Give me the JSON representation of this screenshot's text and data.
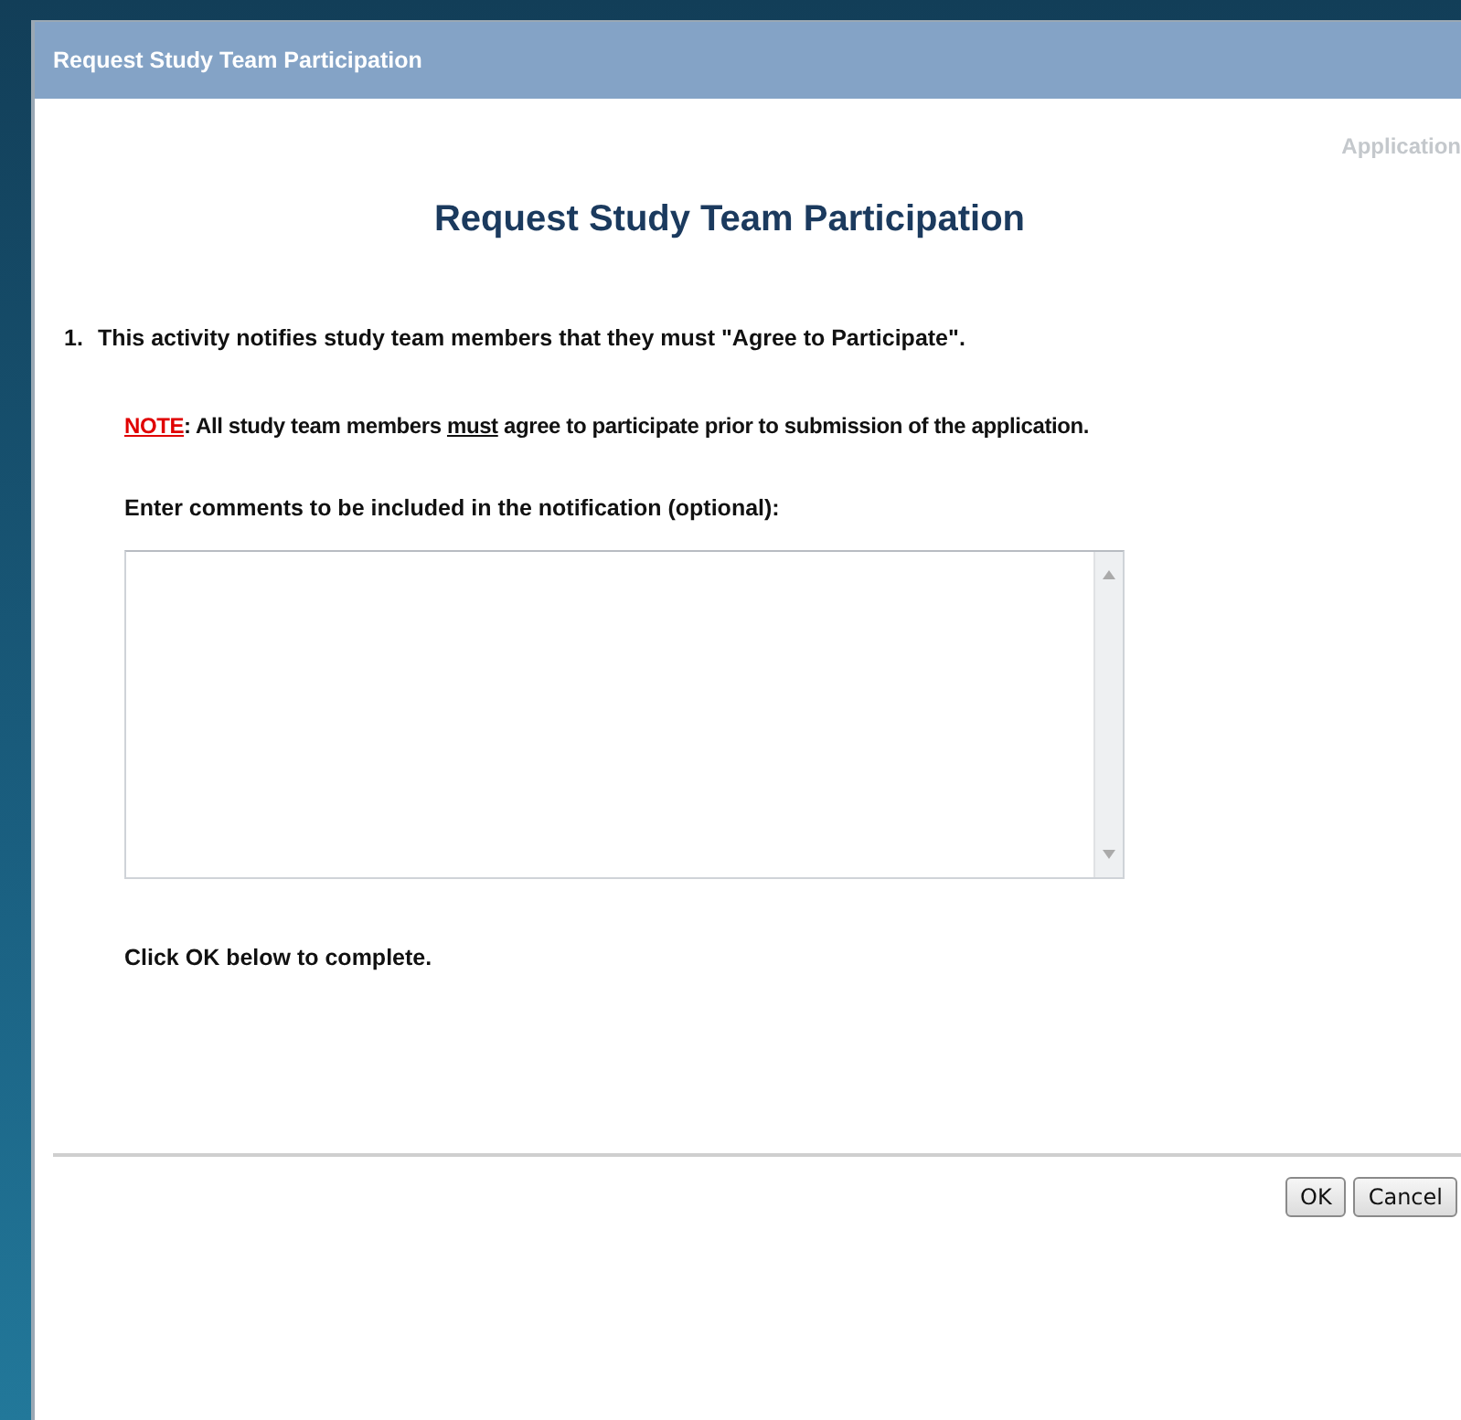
{
  "window": {
    "title": "Request Study Team Participation"
  },
  "context_label": "Application",
  "heading": "Request Study Team Participation",
  "step": {
    "number": "1.",
    "text": "This activity notifies study team members that they must \"Agree to Participate\"."
  },
  "note": [
    {
      "kind": "alert",
      "text": "NOTE"
    },
    {
      "kind": "plain",
      "text": ": All study team members "
    },
    {
      "kind": "underline",
      "text": "must"
    },
    {
      "kind": "plain",
      "text": " agree to participate prior to submission of the application."
    }
  ],
  "comments": {
    "label": "Enter comments to be included in the notification (optional):"
  },
  "instruction": "Click OK below to complete.",
  "buttons": [
    "OK",
    "Cancel"
  ]
}
